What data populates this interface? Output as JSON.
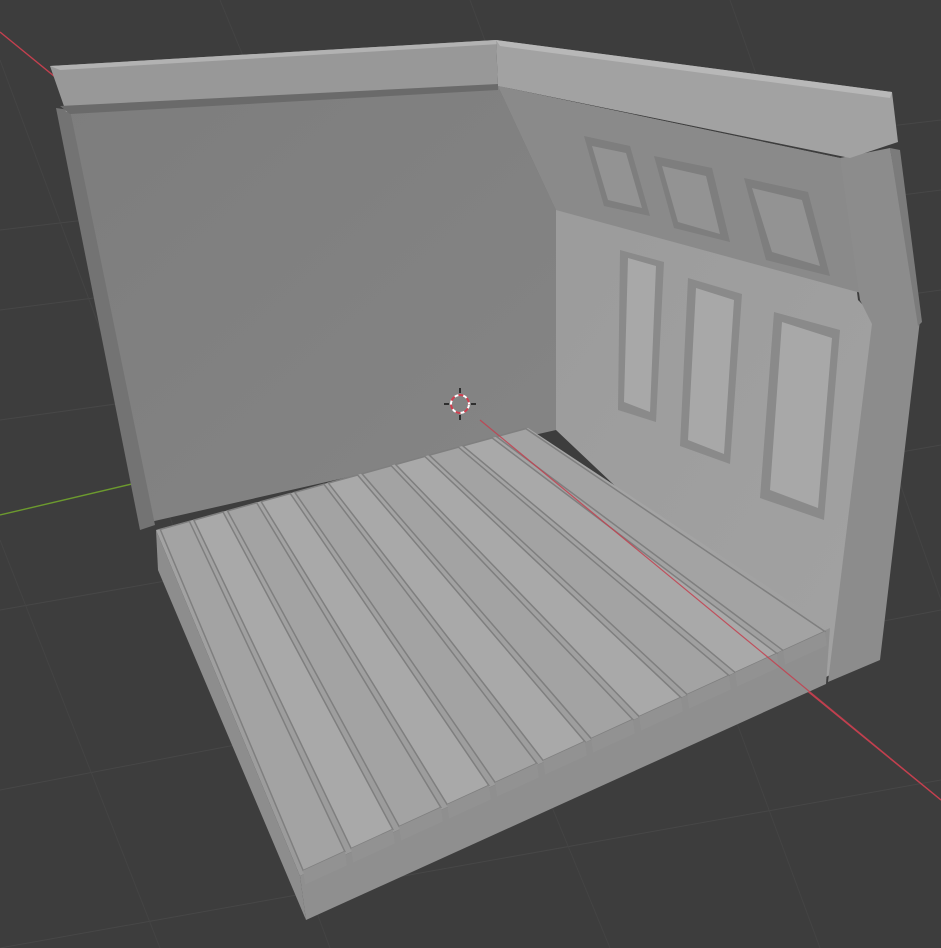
{
  "viewport": {
    "background_color": "#3d3d3d",
    "grid_color": "#474747",
    "x_axis_color": "#c4404f",
    "y_axis_color": "#6c9a2e"
  },
  "scene": {
    "object": "room-diorama",
    "surface_color": "#8e8e8e",
    "cursor_icon": "3d-cursor-icon"
  }
}
